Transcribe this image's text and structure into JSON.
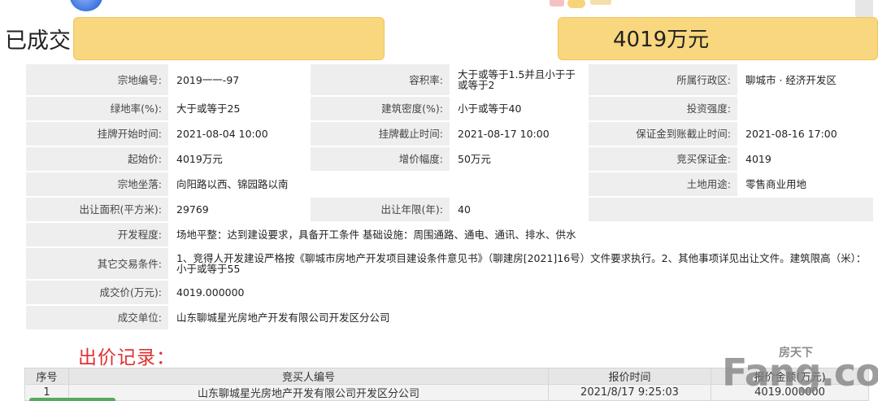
{
  "header": {
    "status_label": "已成交",
    "final_price_display": "4019万元"
  },
  "info_table": {
    "parcel_no_label": "宗地编号:",
    "parcel_no": "2019一一-97",
    "far_label": "容积率:",
    "far": "大于或等于1.5并且小于于或等于2",
    "district_label": "所属行政区:",
    "district": "聊城市 · 经济开发区",
    "green_label": "绿地率(%):",
    "green": "大于或等于25",
    "density_label": "建筑密度(%):",
    "density": "小于或等于40",
    "invest_label": "投资强度:",
    "invest": "",
    "list_start_label": "挂牌开始时间:",
    "list_start": "2021-08-04 10:00",
    "list_end_label": "挂牌截止时间:",
    "list_end": "2021-08-17 10:00",
    "deposit_deadline_label": "保证金到账截止时间:",
    "deposit_deadline": "2021-08-16 17:00",
    "start_price_label": "起始价:",
    "start_price": "4019万元",
    "increment_label": "增价幅度:",
    "increment": "50万元",
    "bid_deposit_label": "竞买保证金:",
    "bid_deposit": "4019",
    "location_label": "宗地坐落:",
    "location": "向阳路以西、锦园路以南",
    "land_use_label": "土地用途:",
    "land_use": "零售商业用地",
    "area_label": "出让面积(平方米):",
    "area": "29769",
    "term_label": "出让年限(年):",
    "term": "40",
    "dev_label": "开发程度:",
    "dev": "场地平整：达到建设要求，具备开工条件  基础设施：周围通路、通电、通讯、排水、供水",
    "other_label": "其它交易条件:",
    "other": "1、竞得人开发建设严格按《聊城市房地产开发项目建设条件意见书》（聊建房[2021]16号）文件要求执行。2、其他事项详见出让文件。建筑限高（米）：小于或等于55",
    "deal_price_label": "成交价(万元):",
    "deal_price": "4019.000000",
    "deal_unit_label": "成交单位:",
    "deal_unit": "山东聊城星光房地产开发有限公司开发区分公司"
  },
  "bid_records": {
    "title": "出价记录：",
    "headers": [
      "序号",
      "竞买人编号",
      "报价时间",
      "报价金额(万元)"
    ],
    "rows": [
      {
        "no": "1",
        "bidder": "山东聊城星光房地产开发有限公司开发区分公司",
        "time": "2021/8/17 9:25:03",
        "amount": "4019.000000"
      }
    ]
  },
  "watermark": {
    "text": "Fang.com",
    "small_text": "房天下"
  },
  "colors": {
    "highlight": "#f8d77e",
    "label_bg": "#eeeeee",
    "bid_title": "#e03131"
  }
}
